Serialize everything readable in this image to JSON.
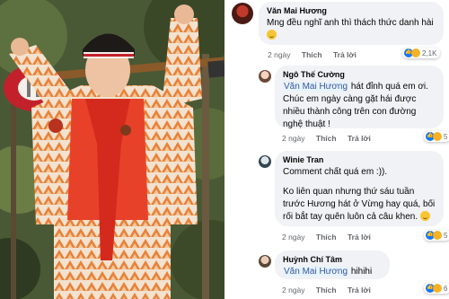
{
  "photo": {
    "alt": "Man in orange patterned suit holding an electric guitar",
    "colors": {
      "suit": "#e8823a",
      "shirt": "#e8412a",
      "guitar": "#c2212b",
      "foliage": "#4c5a34"
    }
  },
  "comments": [
    {
      "author": "Văn Mai Hương",
      "text": "Mng đều nghĩ anh thì thách thức danh hài",
      "emoji": "smile-emoji",
      "time": "2 ngày",
      "like": "Thích",
      "reply": "Trả lời",
      "reactions": "2,1K"
    },
    {
      "author": "Ngô Thế Cường",
      "mention": "Văn Mai Hương",
      "text_line1": "hát đỉnh quá em ơi.",
      "text_rest": "Chúc em ngày càng gặt hái được nhiều thành công trên con đường  nghệ thuật !",
      "time": "2 ngày",
      "like": "Thích",
      "reply": "Trả lời",
      "reactions": "5"
    },
    {
      "author": "Winie Tran",
      "text": "Comment chất quá em :)).",
      "text2": "Ko liên quan nhưng thứ sáu tuần trước Hương hát ở Vừng hay quá, bối rối bắt tay quên luôn cả câu khen.",
      "emoji": "grin-emoji",
      "time": "2 ngày",
      "like": "Thích",
      "reply": "Trả lời",
      "reactions": "5"
    },
    {
      "author": "Huỳnh Chí Tâm",
      "mention": "Văn Mai Hương",
      "text": "hihihi",
      "time": "2 ngày",
      "like": "Thích",
      "reply": "Trả lời",
      "reactions": "6"
    }
  ]
}
